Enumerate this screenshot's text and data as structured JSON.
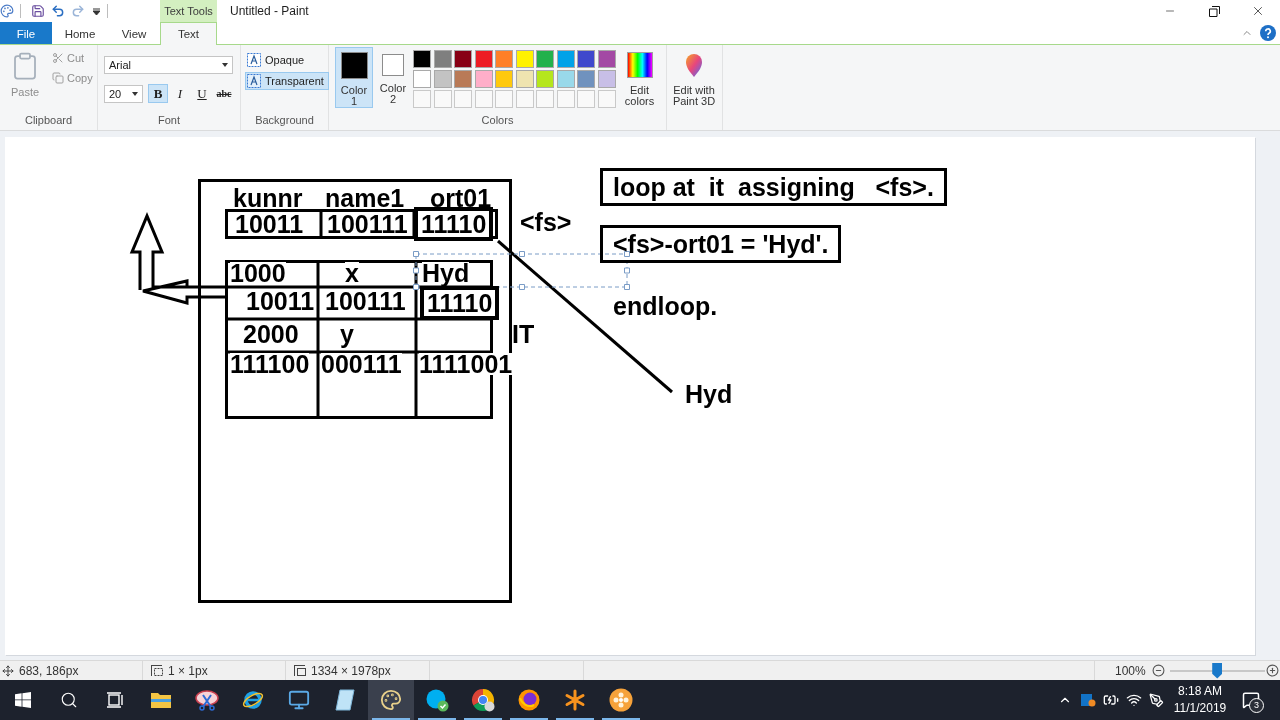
{
  "title_bar": {
    "contextual_group": "Text Tools",
    "title": "Untitled - Paint"
  },
  "tabs": [
    {
      "label": "File",
      "kind": "file",
      "selected": false
    },
    {
      "label": "Home",
      "kind": "tab",
      "selected": false
    },
    {
      "label": "View",
      "kind": "tab",
      "selected": false
    },
    {
      "label": "Text",
      "kind": "contextual",
      "selected": true
    }
  ],
  "ribbon": {
    "clipboard": {
      "label": "Clipboard",
      "paste": {
        "label": "Paste",
        "disabled": true
      },
      "actions": [
        {
          "kind": "cut",
          "label": "Cut",
          "disabled": true
        },
        {
          "kind": "copy",
          "label": "Copy",
          "disabled": true
        }
      ]
    },
    "font": {
      "label": "Font",
      "family": "Arial",
      "size": "20",
      "styles": [
        {
          "kind": "bold",
          "label": "B",
          "selected": true
        },
        {
          "kind": "italic",
          "label": "I",
          "selected": false
        },
        {
          "kind": "underline",
          "label": "U",
          "selected": false
        },
        {
          "kind": "strikethrough",
          "label": "abc",
          "selected": false
        }
      ]
    },
    "background": {
      "label": "Background",
      "options": [
        {
          "label": "Opaque",
          "selected": false
        },
        {
          "label": "Transparent",
          "selected": true
        }
      ]
    },
    "colors": {
      "label": "Colors",
      "slots": [
        {
          "label": "Color 1",
          "color": "#000000",
          "selected": true
        },
        {
          "label": "Color 2",
          "color": "#ffffff",
          "selected": false
        }
      ],
      "palette": [
        {
          "color": "#000000"
        },
        {
          "color": "#7f7f7f"
        },
        {
          "color": "#880015"
        },
        {
          "color": "#ed1c24"
        },
        {
          "color": "#ff7f27"
        },
        {
          "color": "#fff200"
        },
        {
          "color": "#22b14c"
        },
        {
          "color": "#00a2e8"
        },
        {
          "color": "#3f48cc"
        },
        {
          "color": "#a349a4"
        },
        {
          "color": "#ffffff"
        },
        {
          "color": "#c3c3c3"
        },
        {
          "color": "#b97a57"
        },
        {
          "color": "#ffaec9"
        },
        {
          "color": "#ffc90e"
        },
        {
          "color": "#efe4b0"
        },
        {
          "color": "#b5e61d"
        },
        {
          "color": "#99d9ea"
        },
        {
          "color": "#7092be"
        },
        {
          "color": "#c8bfe7"
        }
      ],
      "edit_colors": "Edit colors"
    },
    "paint3d": {
      "label": "Edit with Paint 3D"
    }
  },
  "canvas": {
    "work_area": {
      "columns": [
        "kunnr",
        "name1",
        "ort01"
      ],
      "cells": [
        {
          "text": "10011",
          "highlighted": false
        },
        {
          "text": "100111",
          "highlighted": false
        },
        {
          "text": "11110",
          "highlighted": true
        }
      ],
      "label": "<fs>"
    },
    "internal_table": {
      "rows": [
        [
          {
            "text": "1000",
            "highlighted": false
          },
          {
            "text": "x",
            "highlighted": false
          },
          {
            "text": "Hyd",
            "highlighted": false
          }
        ],
        [
          {
            "text": "10011",
            "highlighted": false
          },
          {
            "text": "100111",
            "highlighted": false
          },
          {
            "text": "11110",
            "highlighted": true
          }
        ],
        [
          {
            "text": "2000",
            "highlighted": false
          },
          {
            "text": "y",
            "highlighted": false
          }
        ],
        [
          {
            "text": "111100",
            "highlighted": false
          },
          {
            "text": "000111",
            "highlighted": false
          },
          {
            "text": "1111001",
            "highlighted": false
          }
        ]
      ],
      "label": "IT"
    },
    "code": [
      {
        "text": "loop at  it  assigning   <fs>.",
        "boxed": true
      },
      {
        "text": "<fs>-ort01 = 'Hyd'.",
        "boxed": true
      },
      {
        "text": "endloop.",
        "boxed": false
      }
    ],
    "callout": "Hyd"
  },
  "status_bar": {
    "cursor": "683, 186px",
    "selection": "1 × 1px",
    "image_size": "1334 × 1978px",
    "zoom": "100%",
    "zoom_slider": {
      "level": 0.5
    }
  },
  "taskbar": {
    "items": [
      {
        "kind": "start",
        "running": false,
        "selected": false
      },
      {
        "kind": "search",
        "running": false,
        "selected": false
      },
      {
        "kind": "taskview",
        "running": false,
        "selected": false
      },
      {
        "kind": "folder",
        "running": false,
        "selected": false
      },
      {
        "kind": "scissors",
        "running": false,
        "selected": false
      },
      {
        "kind": "ie",
        "running": false,
        "selected": false
      },
      {
        "kind": "monitor",
        "running": false,
        "selected": false
      },
      {
        "kind": "notepad",
        "running": false,
        "selected": false
      },
      {
        "kind": "paint",
        "running": true,
        "selected": true
      },
      {
        "kind": "chat",
        "running": true,
        "selected": false
      },
      {
        "kind": "chrome",
        "running": true,
        "selected": false
      },
      {
        "kind": "firefox",
        "running": true,
        "selected": false
      },
      {
        "kind": "asterisk",
        "running": true,
        "selected": false
      },
      {
        "kind": "flower",
        "running": true,
        "selected": false
      }
    ],
    "clock": {
      "time": "8:18 AM",
      "date": "11/1/2019"
    },
    "notifications": "3"
  }
}
